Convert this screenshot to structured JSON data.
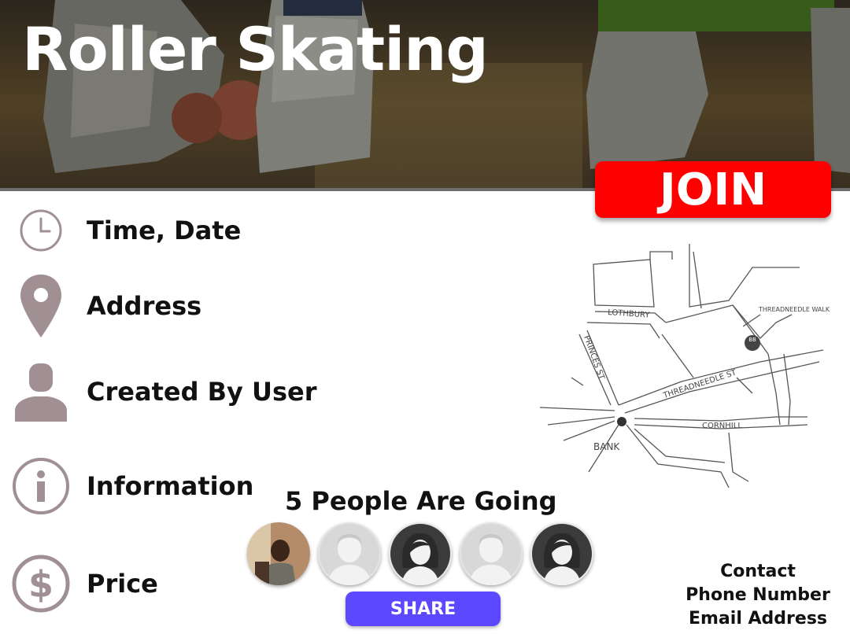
{
  "event": {
    "title": "Roller Skating",
    "join_label": "JOIN"
  },
  "details": [
    {
      "icon": "clock-icon",
      "label": "Time, Date"
    },
    {
      "icon": "location-pin-icon",
      "label": "Address"
    },
    {
      "icon": "user-icon",
      "label": "Created By User"
    },
    {
      "icon": "info-icon",
      "label": "Information"
    },
    {
      "icon": "dollar-icon",
      "label": "Price"
    }
  ],
  "attendance": {
    "going_text": "5 People Are Going",
    "share_label": "SHARE"
  },
  "map": {
    "streets": [
      "LOTHBURY",
      "THREADNEEDLE WALK",
      "PRINCES ST",
      "THREADNEEDLE ST",
      "CORNHILL",
      "BANK"
    ],
    "marker": "BB"
  },
  "contact": {
    "heading": "Contact",
    "phone": "Phone Number",
    "email": "Email Address"
  },
  "colors": {
    "join": "#ff0000",
    "share": "#5b48ff",
    "icon": "#a08f93"
  }
}
